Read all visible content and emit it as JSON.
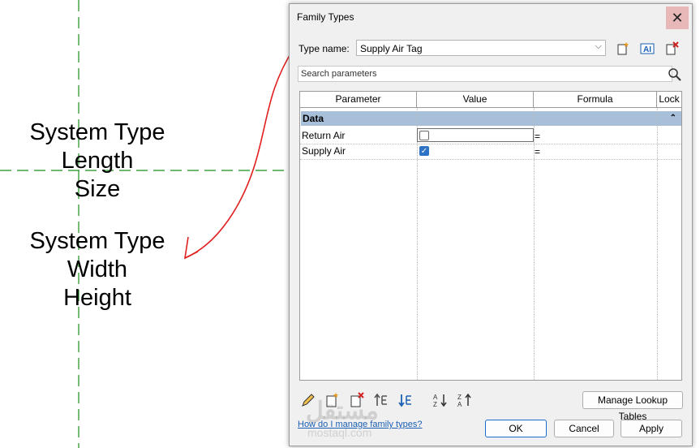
{
  "canvas": {
    "tag_top": [
      "System Type",
      "Length",
      "Size"
    ],
    "tag_bottom": [
      "System Type",
      "Width",
      "Height"
    ]
  },
  "dialog": {
    "title": "Family Types",
    "close_glyph": "✕",
    "type_name_label": "Type name:",
    "type_name_value": "Supply Air Tag",
    "search_placeholder": "Search parameters",
    "columns": [
      "Parameter",
      "Value",
      "Formula",
      "Lock"
    ],
    "group": "Data",
    "rows": [
      {
        "parameter": "Return Air",
        "checked": false,
        "formula": "="
      },
      {
        "parameter": "Supply Air",
        "checked": true,
        "formula": "="
      }
    ],
    "manage_lookup": "Manage Lookup Tables",
    "help_link": "How do I manage family types?",
    "ok": "OK",
    "cancel": "Cancel",
    "apply": "Apply",
    "icons": [
      "new-type-icon",
      "rename-type-icon",
      "delete-type-icon",
      "pencil-icon",
      "new-parameter-icon",
      "delete-parameter-icon",
      "move-up-icon",
      "move-down-icon",
      "sort-ascending-icon",
      "sort-descending-icon",
      "search-icon"
    ],
    "accent_color": "#2f73c6",
    "group_color": "#a7bfd9"
  },
  "watermark": {
    "text": "مستقل",
    "sub": "mostaql.com"
  }
}
